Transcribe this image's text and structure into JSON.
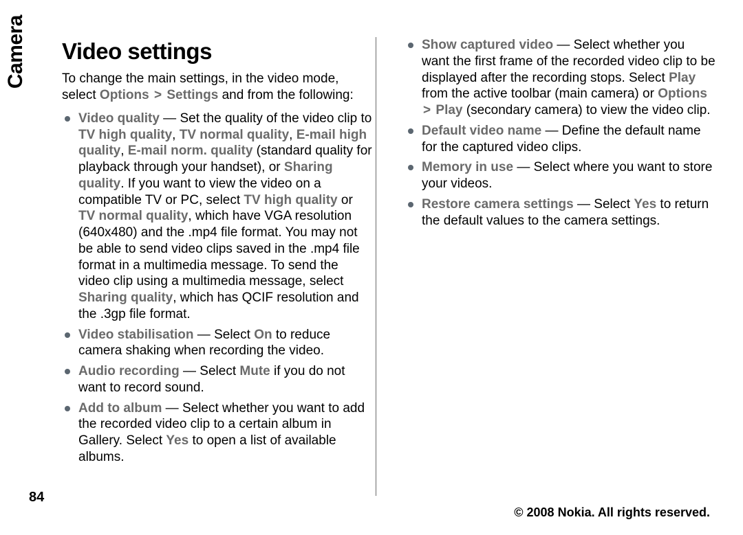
{
  "sideLabel": "Camera",
  "pageNumber": "84",
  "footer": "© 2008 Nokia. All rights reserved.",
  "heading": "Video settings",
  "intro": {
    "t1": "To change the main settings, in the video mode, select ",
    "options": "Options",
    "gt": ">",
    "settings": "Settings",
    "t2": " and from the following:"
  },
  "items": {
    "videoQuality": {
      "label": "Video quality",
      "t1": " — Set the quality of the video clip to ",
      "q1": "TV high quality",
      "c1": ", ",
      "q2": "TV normal quality",
      "c2": ", ",
      "q3": "E-mail high quality",
      "c3": ", ",
      "q4": "E-mail norm. quality",
      "t2": " (standard quality for playback through your handset), or ",
      "q5": "Sharing quality",
      "t3": ". If you want to view the video on a compatible TV or PC, select ",
      "q6": "TV high quality",
      "t4": " or ",
      "q7": "TV normal quality",
      "t5": ", which have VGA resolution (640x480) and the .mp4 file format. You may not be able to send video clips saved in the .mp4 file format in a multimedia message. To send the video clip using a multimedia message, select ",
      "q8": "Sharing quality",
      "t6": ", which has QCIF resolution and the .3gp file format."
    },
    "videoStab": {
      "label": "Video stabilisation",
      "t1": "  — Select ",
      "on": "On",
      "t2": " to reduce camera shaking when recording the video."
    },
    "audio": {
      "label": "Audio recording",
      "t1": "  — Select ",
      "mute": "Mute",
      "t2": " if you do not want to record sound."
    },
    "addAlbum": {
      "label": "Add to album",
      "t1": "  — Select whether you want to add the recorded video clip to a certain album in Gallery. Select ",
      "yes": "Yes",
      "t2": " to open a list of available albums."
    },
    "showCaptured": {
      "label": "Show captured video",
      "t1": "  — Select whether you want the first frame of the recorded video clip to be displayed after the recording stops. Select ",
      "play": "Play",
      "t2": " from the active toolbar (main camera) or ",
      "options": "Options",
      "gt": ">",
      "play2": "Play",
      "t3": " (secondary camera) to view the video clip."
    },
    "defaultName": {
      "label": "Default video name",
      "t1": "  — Define the default name for the captured video clips."
    },
    "memory": {
      "label": "Memory in use",
      "t1": "  — Select where you want to store your videos."
    },
    "restore": {
      "label": "Restore camera settings",
      "t1": "  — Select ",
      "yes": "Yes",
      "t2": " to return the default values to the camera settings."
    }
  }
}
